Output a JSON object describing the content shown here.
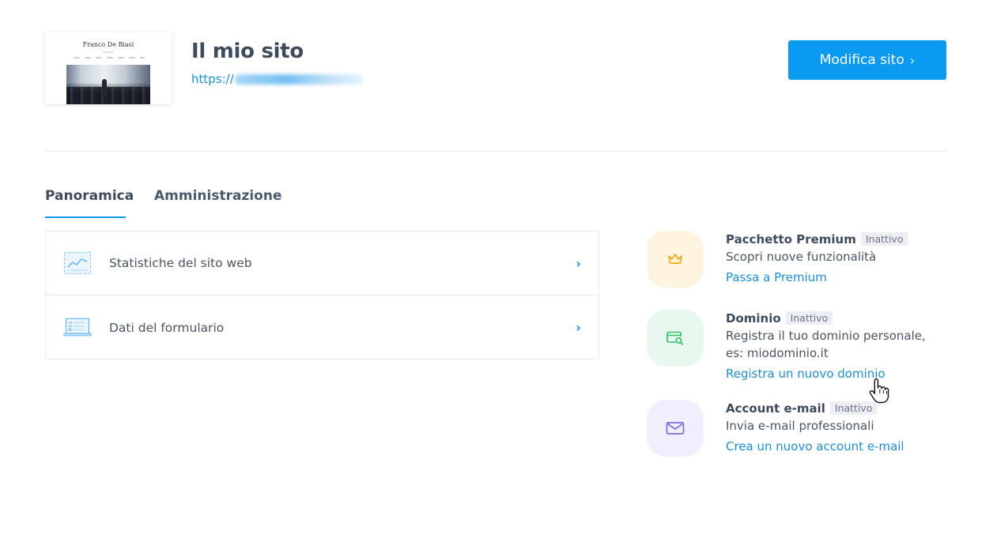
{
  "thumbnail": {
    "site_name": "Franco De Biasi",
    "tagline": "Biografia"
  },
  "header": {
    "title": "Il mio sito",
    "url_prefix": "https://",
    "edit_button": "Modifica sito",
    "edit_chevron": "›"
  },
  "tabs": [
    {
      "label": "Panoramica",
      "active": true
    },
    {
      "label": "Amministrazione",
      "active": false
    }
  ],
  "panel": {
    "rows": [
      {
        "label": "Statistiche del sito web",
        "icon": "chart-icon"
      },
      {
        "label": "Dati del formulario",
        "icon": "form-laptop-icon"
      }
    ],
    "chevron": "›"
  },
  "features": [
    {
      "title": "Pacchetto Premium",
      "badge": "Inattivo",
      "description": "Scopri nuove funzionalità",
      "link": "Passa a Premium",
      "icon": "crown-icon",
      "color": "#f3a91c"
    },
    {
      "title": "Dominio",
      "badge": "Inattivo",
      "description": "Registra il tuo dominio personale, es: miodominio.it",
      "link": "Registra un nuovo dominio",
      "icon": "domain-search-icon",
      "color": "#2fc26b"
    },
    {
      "title": "Account e-mail",
      "badge": "Inattivo",
      "description": "Invia e-mail professionali",
      "link": "Crea un nuovo account e-mail",
      "icon": "envelope-icon",
      "color": "#7b6fe0"
    }
  ],
  "colors": {
    "accent": "#0a9bf0",
    "link": "#1a8fd6",
    "text": "#3d4b5d"
  }
}
